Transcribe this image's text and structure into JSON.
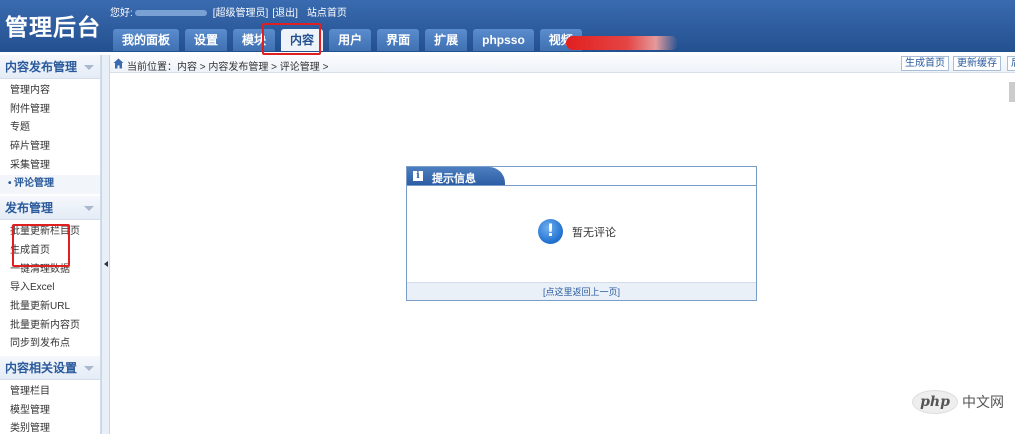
{
  "app": {
    "logo": "管理后台"
  },
  "userbar": {
    "greeting": "您好:",
    "role": "[超级管理员]",
    "logout": "[退出]",
    "site_home": "站点首页"
  },
  "tabs": [
    {
      "label": "我的面板",
      "active": false
    },
    {
      "label": "设置",
      "active": false
    },
    {
      "label": "模块",
      "active": false
    },
    {
      "label": "内容",
      "active": true
    },
    {
      "label": "用户",
      "active": false
    },
    {
      "label": "界面",
      "active": false
    },
    {
      "label": "扩展",
      "active": false
    },
    {
      "label": "phpsso",
      "active": false
    },
    {
      "label": "视频",
      "active": false
    }
  ],
  "sidebar": {
    "sections": [
      {
        "title": "内容发布管理",
        "items": [
          "管理内容",
          "附件管理",
          "专题",
          "碎片管理",
          "采集管理",
          "评论管理"
        ],
        "active_index": 5
      },
      {
        "title": "发布管理",
        "items": [
          "批量更新栏目页",
          "生成首页",
          "一键清理数据",
          "导入Excel",
          "批量更新URL",
          "批量更新内容页",
          "同步到发布点"
        ]
      },
      {
        "title": "内容相关设置",
        "items": [
          "管理栏目",
          "模型管理",
          "类别管理"
        ]
      }
    ]
  },
  "breadcrumb": {
    "text": "当前位置：内容 > 内容发布管理 > 评论管理 >",
    "buttons": {
      "generate_home": "生成首页",
      "refresh_cache": "更新缓存",
      "more": "后"
    }
  },
  "message": {
    "header": "提示信息",
    "icon": "i",
    "text": "暂无评论",
    "back_link": "[点这里返回上一页]"
  },
  "watermark": {
    "logo": "php",
    "text": "中文网"
  },
  "colors": {
    "header_blue": "#2a5a9c",
    "highlight_red": "#e02020"
  }
}
